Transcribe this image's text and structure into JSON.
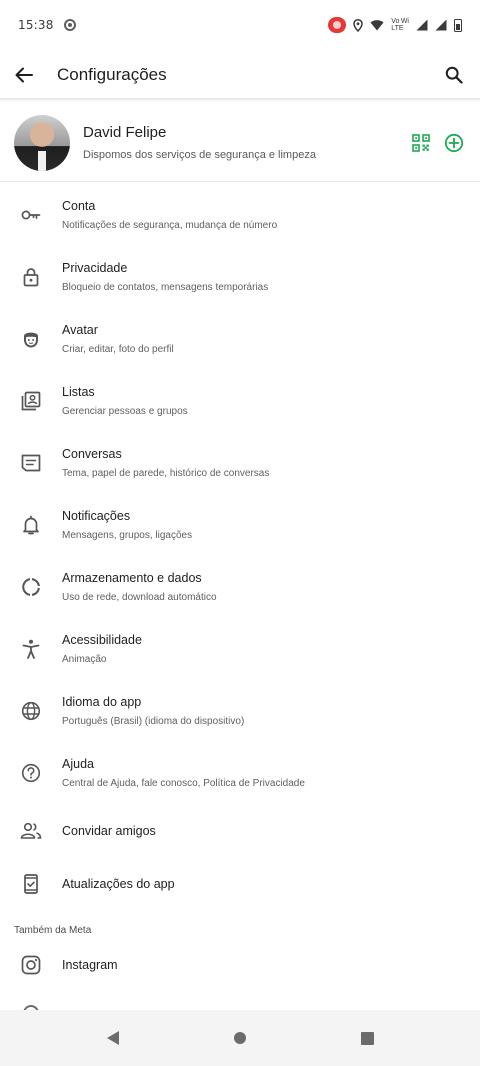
{
  "status_bar": {
    "time": "15:38",
    "network_label_top": "Vo Wi",
    "network_label_bottom": "LTE"
  },
  "app_bar": {
    "title": "Configurações",
    "back_icon": "arrow-back-icon",
    "search_icon": "search-icon"
  },
  "profile": {
    "name": "David Felipe",
    "status": "Dispomos dos serviços de segurança e limpeza",
    "actions": [
      "qr-code-icon",
      "add-circle-icon"
    ],
    "accent_color": "#1fa855"
  },
  "menu": [
    {
      "icon": "key-icon",
      "title": "Conta",
      "subtitle": "Notificações de segurança, mudança de número"
    },
    {
      "icon": "lock-icon",
      "title": "Privacidade",
      "subtitle": "Bloqueio de contatos, mensagens temporárias"
    },
    {
      "icon": "avatar-face-icon",
      "title": "Avatar",
      "subtitle": "Criar, editar, foto do perfil"
    },
    {
      "icon": "contacts-list-icon",
      "title": "Listas",
      "subtitle": "Gerenciar pessoas e grupos"
    },
    {
      "icon": "chat-icon",
      "title": "Conversas",
      "subtitle": "Tema, papel de parede, histórico de conversas"
    },
    {
      "icon": "bell-icon",
      "title": "Notificações",
      "subtitle": "Mensagens, grupos, ligações"
    },
    {
      "icon": "storage-ring-icon",
      "title": "Armazenamento e dados",
      "subtitle": "Uso de rede, download automático"
    },
    {
      "icon": "accessibility-icon",
      "title": "Acessibilidade",
      "subtitle": "Animação"
    },
    {
      "icon": "globe-icon",
      "title": "Idioma do app",
      "subtitle": "Português (Brasil) (idioma do dispositivo)"
    },
    {
      "icon": "help-icon",
      "title": "Ajuda",
      "subtitle": "Central de Ajuda, fale conosco, Política de Privacidade"
    },
    {
      "icon": "people-icon",
      "title": "Convidar amigos"
    },
    {
      "icon": "phone-update-icon",
      "title": "Atualizações do app"
    }
  ],
  "meta_section": {
    "label": "Também da Meta",
    "items": [
      {
        "icon": "instagram-icon",
        "title": "Instagram"
      }
    ]
  },
  "nav_bar": {
    "buttons": [
      "nav-back-icon",
      "nav-home-icon",
      "nav-recents-icon"
    ]
  }
}
